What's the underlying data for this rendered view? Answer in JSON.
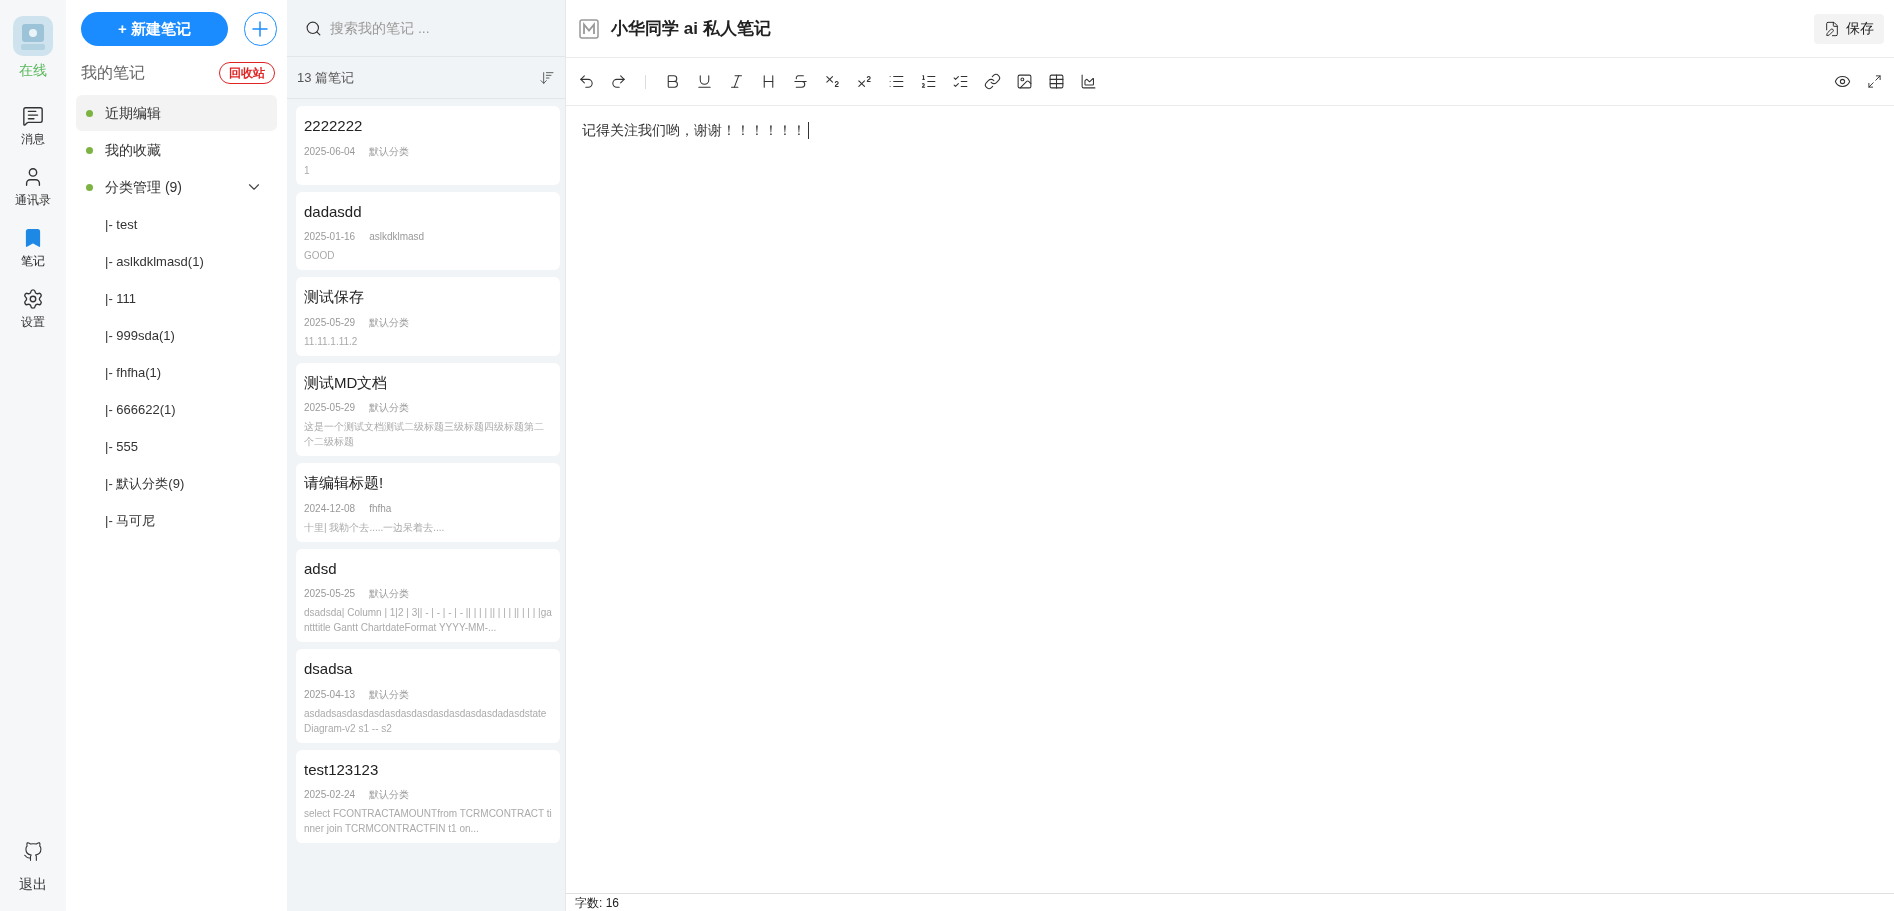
{
  "nav": {
    "status": "在线",
    "items": [
      {
        "kind": "messages",
        "label": "消息",
        "selected": false
      },
      {
        "kind": "contacts",
        "label": "通讯录",
        "selected": false
      },
      {
        "kind": "notes",
        "label": "笔记",
        "selected": true
      },
      {
        "kind": "settings",
        "label": "设置",
        "selected": false
      }
    ],
    "logout": "退出"
  },
  "categories": {
    "new_note": "+ 新建笔记",
    "title": "我的笔记",
    "trash": "回收站",
    "items": [
      {
        "label": "近期编辑",
        "selected": true
      },
      {
        "label": "我的收藏",
        "selected": false
      },
      {
        "label": "分类管理 (9)",
        "selected": false,
        "expanded": true,
        "children": [
          {
            "label": "|- test"
          },
          {
            "label": "|- aslkdklmasd(1)"
          },
          {
            "label": "|- 111"
          },
          {
            "label": "|- 999sda(1)"
          },
          {
            "label": "|- fhfha(1)"
          },
          {
            "label": "|- 666622(1)"
          },
          {
            "label": "|- 555"
          },
          {
            "label": "|- 默认分类(9)"
          },
          {
            "label": "|- 马可尼"
          }
        ]
      }
    ]
  },
  "note_list": {
    "search_placeholder": "搜索我的笔记 ...",
    "count": "13 篇笔记",
    "notes": [
      {
        "title": "2222222",
        "date": "2025-06-04",
        "category": "默认分类",
        "preview": "1"
      },
      {
        "title": "dadasdd",
        "date": "2025-01-16",
        "category": "aslkdklmasd",
        "preview": "GOOD"
      },
      {
        "title": "测试保存",
        "date": "2025-05-29",
        "category": "默认分类",
        "preview": "11.11.1.11.2"
      },
      {
        "title": "测试MD文档",
        "date": "2025-05-29",
        "category": "默认分类",
        "preview": "这是一个测试文档测试二级标题三级标题四级标题第二个二级标题"
      },
      {
        "title": "请编辑标题!",
        "date": "2024-12-08",
        "category": "fhfha",
        "preview": "十里| 我勒个去.....一边呆着去...."
      },
      {
        "title": "adsd",
        "date": "2025-05-25",
        "category": "默认分类",
        "preview": "dsadsda| Column | 1|2 | 3|| - | - | - | - || | | | || | | | || | | | |gantttitle Gantt ChartdateFormat YYYY-MM-..."
      },
      {
        "title": "dsadsa",
        "date": "2025-04-13",
        "category": "默认分类",
        "preview": "asdadsasdasdasdasdasdasdasdasdasdasdadasdstateDiagram-v2 s1 -- s2"
      },
      {
        "title": "test123123",
        "date": "2025-02-24",
        "category": "默认分类",
        "preview": "select FCONTRACTAMOUNTfrom TCRMCONTRACT tinner join TCRMCONTRACTFIN t1 on..."
      }
    ]
  },
  "editor": {
    "title": "小华同学 ai 私人笔记",
    "save": "保存",
    "content": "记得关注我们哟，谢谢！！！！！！",
    "word_count": "字数: 16"
  }
}
